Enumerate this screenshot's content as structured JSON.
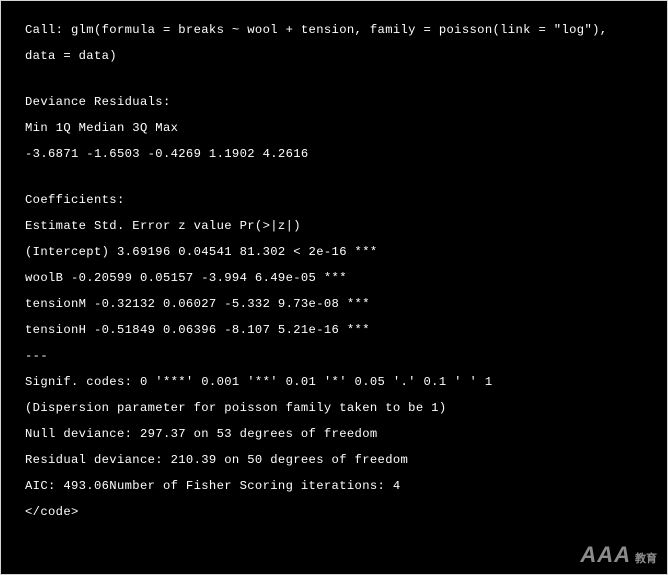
{
  "output": {
    "lines": [
      {
        "text": "Call: glm(formula = breaks ~ wool + tension, family = poisson(link = \"log\"),",
        "gap": false
      },
      {
        "text": "data = data)",
        "gap": true
      },
      {
        "text": "Deviance Residuals:",
        "gap": false
      },
      {
        "text": "Min 1Q Median 3Q Max",
        "gap": false
      },
      {
        "text": "-3.6871 -1.6503 -0.4269 1.1902 4.2616",
        "gap": true
      },
      {
        "text": "Coefficients:",
        "gap": false
      },
      {
        "text": "Estimate Std. Error z value Pr(>|z|)",
        "gap": false
      },
      {
        "text": "(Intercept) 3.69196 0.04541 81.302 < 2e-16 ***",
        "gap": false
      },
      {
        "text": "woolB -0.20599 0.05157 -3.994 6.49e-05 ***",
        "gap": false
      },
      {
        "text": "tensionM -0.32132 0.06027 -5.332 9.73e-08 ***",
        "gap": false
      },
      {
        "text": "tensionH -0.51849 0.06396 -8.107 5.21e-16 ***",
        "gap": false
      },
      {
        "text": "---",
        "gap": false
      },
      {
        "text": "Signif. codes: 0 '***' 0.001 '**' 0.01 '*' 0.05 '.' 0.1 ' ' 1",
        "gap": false
      },
      {
        "text": "(Dispersion parameter for poisson family taken to be 1)",
        "gap": false
      },
      {
        "text": "Null deviance: 297.37 on 53 degrees of freedom",
        "gap": false
      },
      {
        "text": "Residual deviance: 210.39 on 50 degrees of freedom",
        "gap": false
      },
      {
        "text": "AIC: 493.06Number of Fisher Scoring iterations: 4",
        "gap": false
      },
      {
        "text": "</code>",
        "gap": false
      }
    ]
  },
  "watermark": {
    "main": "AAA",
    "sub": "教育"
  }
}
